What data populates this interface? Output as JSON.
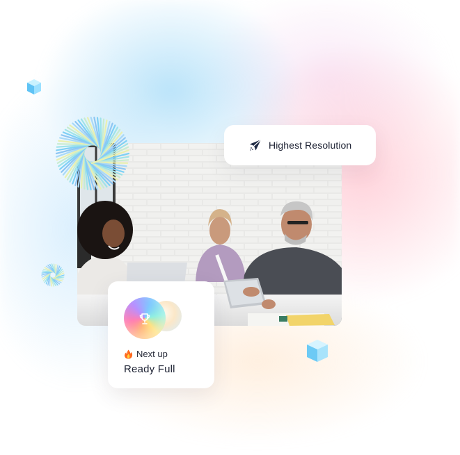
{
  "badges": {
    "resolution": {
      "icon": "paper-plane-icon",
      "label": "Highest Resolution"
    },
    "next_up": {
      "icon": "fire-icon",
      "label": "Next up",
      "status": "Ready Full",
      "orb_icon": "trophy-icon"
    }
  },
  "photo": {
    "subject": "meeting-photo"
  },
  "colors": {
    "card_background": "#ffffff",
    "text_primary": "#1d2233",
    "icon_navy": "#1f2a44"
  }
}
